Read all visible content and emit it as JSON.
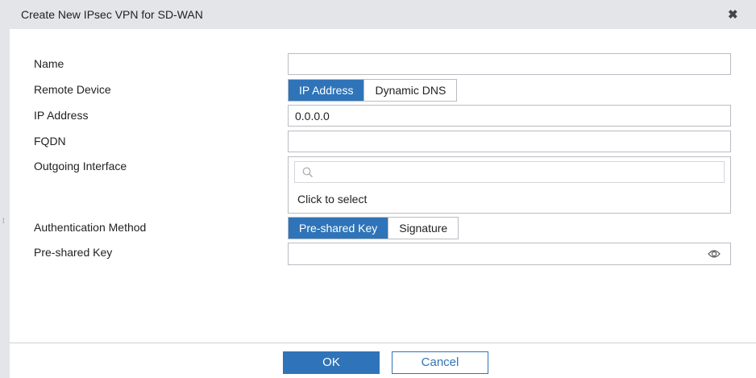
{
  "dialog": {
    "title": "Create New IPsec VPN for SD-WAN",
    "close_icon": "close-icon"
  },
  "form": {
    "name": {
      "label": "Name",
      "value": ""
    },
    "remote_device": {
      "label": "Remote Device",
      "options": [
        "IP Address",
        "Dynamic DNS"
      ],
      "selected": "IP Address"
    },
    "ip_address": {
      "label": "IP Address",
      "value": "0.0.0.0"
    },
    "fqdn": {
      "label": "FQDN",
      "value": ""
    },
    "outgoing_interface": {
      "label": "Outgoing Interface",
      "search_value": "",
      "placeholder": "Click to select"
    },
    "auth_method": {
      "label": "Authentication Method",
      "options": [
        "Pre-shared Key",
        "Signature"
      ],
      "selected": "Pre-shared Key"
    },
    "psk": {
      "label": "Pre-shared Key",
      "value": ""
    }
  },
  "footer": {
    "ok": "OK",
    "cancel": "Cancel"
  },
  "colors": {
    "accent": "#2f74b8"
  }
}
